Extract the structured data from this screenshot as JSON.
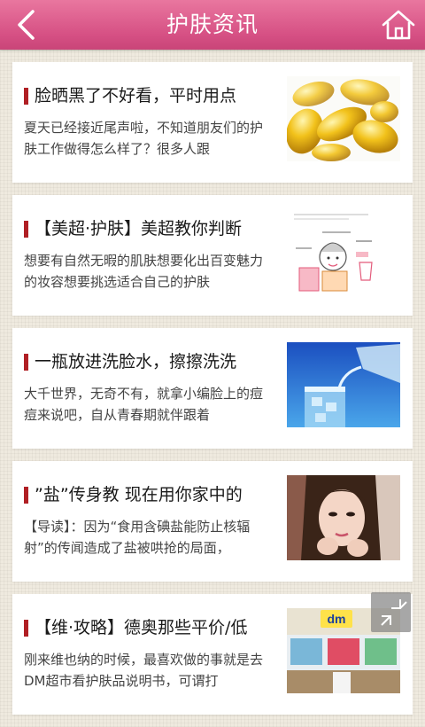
{
  "header": {
    "title": "护肤资讯",
    "back_icon": "chevron-left-icon",
    "home_icon": "home-icon"
  },
  "articles": [
    {
      "title": "脸晒黑了不好看，平时用点",
      "summary": "夏天已经接近尾声啦，不知道朋友们的护肤工作做得怎么样了？很多人跟",
      "image": "vitamin-e-capsules-image"
    },
    {
      "title": "【美超·护肤】美超教你判断",
      "summary": "想要有自然无暇的肌肤想要化出百变魅力的妆容想要挑选适合自己的护肤",
      "image": "skin-type-sketch-image"
    },
    {
      "title": "一瓶放进洗脸水，擦擦洗洗",
      "summary": "大千世界，无奇不有，就拿小编脸上的痘痘来说吧，自从青春期就伴跟着",
      "image": "pouring-water-glass-image"
    },
    {
      "title": "”盐”传身教 现在用你家中的",
      "summary": "【导读】：因为“食用含碘盐能防止核辐射”的传闻造成了盐被哄抢的局面，",
      "image": "woman-portrait-image"
    },
    {
      "title": "【维·攻略】德奥那些平价/低",
      "summary": "刚来维也纳的时候，最喜欢做的事就是去DM超市看护肤品说明书，可谓打",
      "image": "dm-store-image",
      "image_text": "dm"
    }
  ],
  "expand_icon": "collapse-arrows-icon",
  "colors": {
    "header": "#d65084",
    "accent_bar": "#b01f24",
    "background": "#efeadf"
  }
}
